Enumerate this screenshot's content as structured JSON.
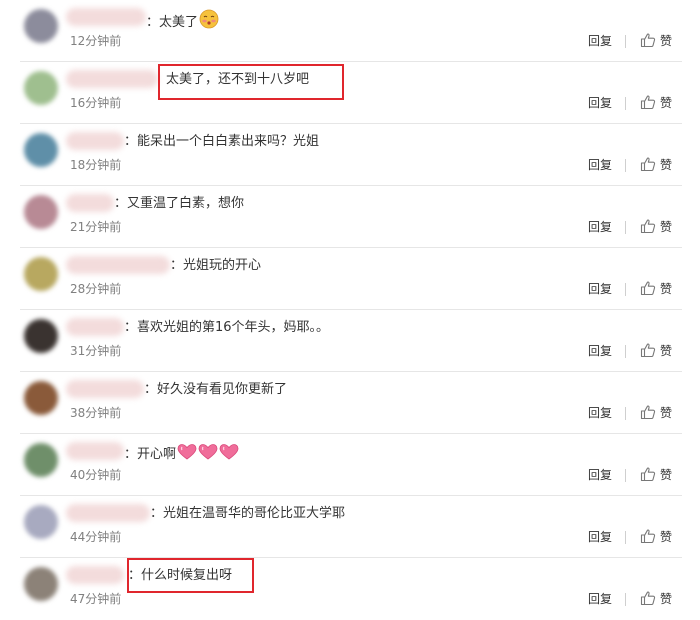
{
  "actions": {
    "reply_label": "回复",
    "like_label": "赞"
  },
  "comments": [
    {
      "text": "：太美了",
      "time": "12分钟前",
      "avatar_color": "#8c8c9c",
      "emoji": "blush"
    },
    {
      "text": "太美了，还不到十八岁吧",
      "time": "16分钟前",
      "avatar_color": "#9fbf8f",
      "highlighted": true
    },
    {
      "text": "：能呆出一个白白素出来吗？光姐",
      "time": "18分钟前",
      "avatar_color": "#5f8fa8"
    },
    {
      "text": "：又重温了白素，想你",
      "time": "21分钟前",
      "avatar_color": "#b88a95"
    },
    {
      "text": "：光姐玩的开心",
      "time": "28分钟前",
      "avatar_color": "#b8a860"
    },
    {
      "text": "：喜欢光姐的第16个年头，妈耶。。",
      "time": "31分钟前",
      "avatar_color": "#3a3330"
    },
    {
      "text": "：好久没有看见你更新了",
      "time": "38分钟前",
      "avatar_color": "#8a5a3a"
    },
    {
      "text": "：开心啊",
      "time": "40分钟前",
      "avatar_color": "#6f8f6a",
      "emoji": "hearts"
    },
    {
      "text": "：光姐在温哥华的哥伦比亚大学耶",
      "time": "44分钟前",
      "avatar_color": "#a8aac0"
    },
    {
      "text": "：什么时候复出呀",
      "time": "47分钟前",
      "avatar_color": "#8c8278",
      "highlighted": true
    }
  ]
}
